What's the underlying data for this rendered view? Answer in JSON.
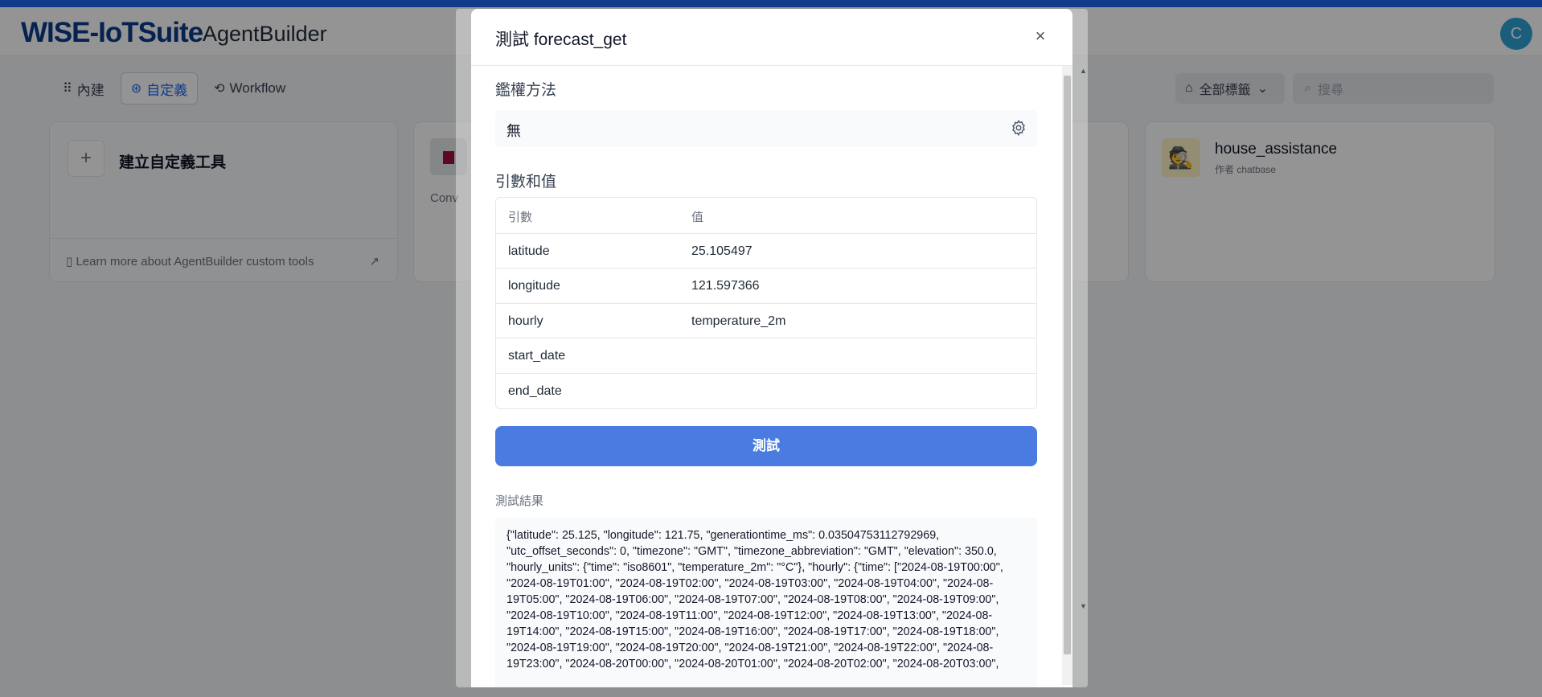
{
  "header": {
    "logo": "WISE-IoTSuite",
    "app_name": "AgentBuilder",
    "avatar_initial": "C"
  },
  "tabs": [
    {
      "label": "內建",
      "icon": "grid-icon"
    },
    {
      "label": "自定義",
      "icon": "custom-icon"
    },
    {
      "label": "Workflow",
      "icon": "workflow-icon"
    }
  ],
  "tag_filter": {
    "label": "全部標籤",
    "icon": "tag-icon"
  },
  "search": {
    "placeholder": "搜尋"
  },
  "create_card": {
    "label": "建立自定義工具",
    "learn_more": "Learn more about AgentBuilder custom tools"
  },
  "tool_cards": [
    {
      "desc": "Conv"
    },
    {
      "title": "house_assistance",
      "author": "作者 chatbase"
    }
  ],
  "modal": {
    "title": "測試 forecast_get",
    "auth": {
      "label": "鑑權方法",
      "value": "無"
    },
    "params": {
      "label": "引數和值",
      "header": {
        "key": "引數",
        "value": "值"
      },
      "rows": [
        {
          "key": "latitude",
          "value": "25.105497"
        },
        {
          "key": "longitude",
          "value": "121.597366"
        },
        {
          "key": "hourly",
          "value": "temperature_2m"
        },
        {
          "key": "start_date",
          "value": ""
        },
        {
          "key": "end_date",
          "value": ""
        }
      ]
    },
    "test_button": "測試",
    "result": {
      "label": "測試結果",
      "text": "{\"latitude\": 25.125, \"longitude\": 121.75, \"generationtime_ms\": 0.03504753112792969, \"utc_offset_seconds\": 0, \"timezone\": \"GMT\", \"timezone_abbreviation\": \"GMT\", \"elevation\": 350.0, \"hourly_units\": {\"time\": \"iso8601\", \"temperature_2m\": \"°C\"}, \"hourly\": {\"time\": [\"2024-08-19T00:00\", \"2024-08-19T01:00\", \"2024-08-19T02:00\", \"2024-08-19T03:00\", \"2024-08-19T04:00\", \"2024-08-19T05:00\", \"2024-08-19T06:00\", \"2024-08-19T07:00\", \"2024-08-19T08:00\", \"2024-08-19T09:00\", \"2024-08-19T10:00\", \"2024-08-19T11:00\", \"2024-08-19T12:00\", \"2024-08-19T13:00\", \"2024-08-19T14:00\", \"2024-08-19T15:00\", \"2024-08-19T16:00\", \"2024-08-19T17:00\", \"2024-08-19T18:00\", \"2024-08-19T19:00\", \"2024-08-19T20:00\", \"2024-08-19T21:00\", \"2024-08-19T22:00\", \"2024-08-19T23:00\", \"2024-08-20T00:00\", \"2024-08-20T01:00\", \"2024-08-20T02:00\", \"2024-08-20T03:00\","
    }
  }
}
